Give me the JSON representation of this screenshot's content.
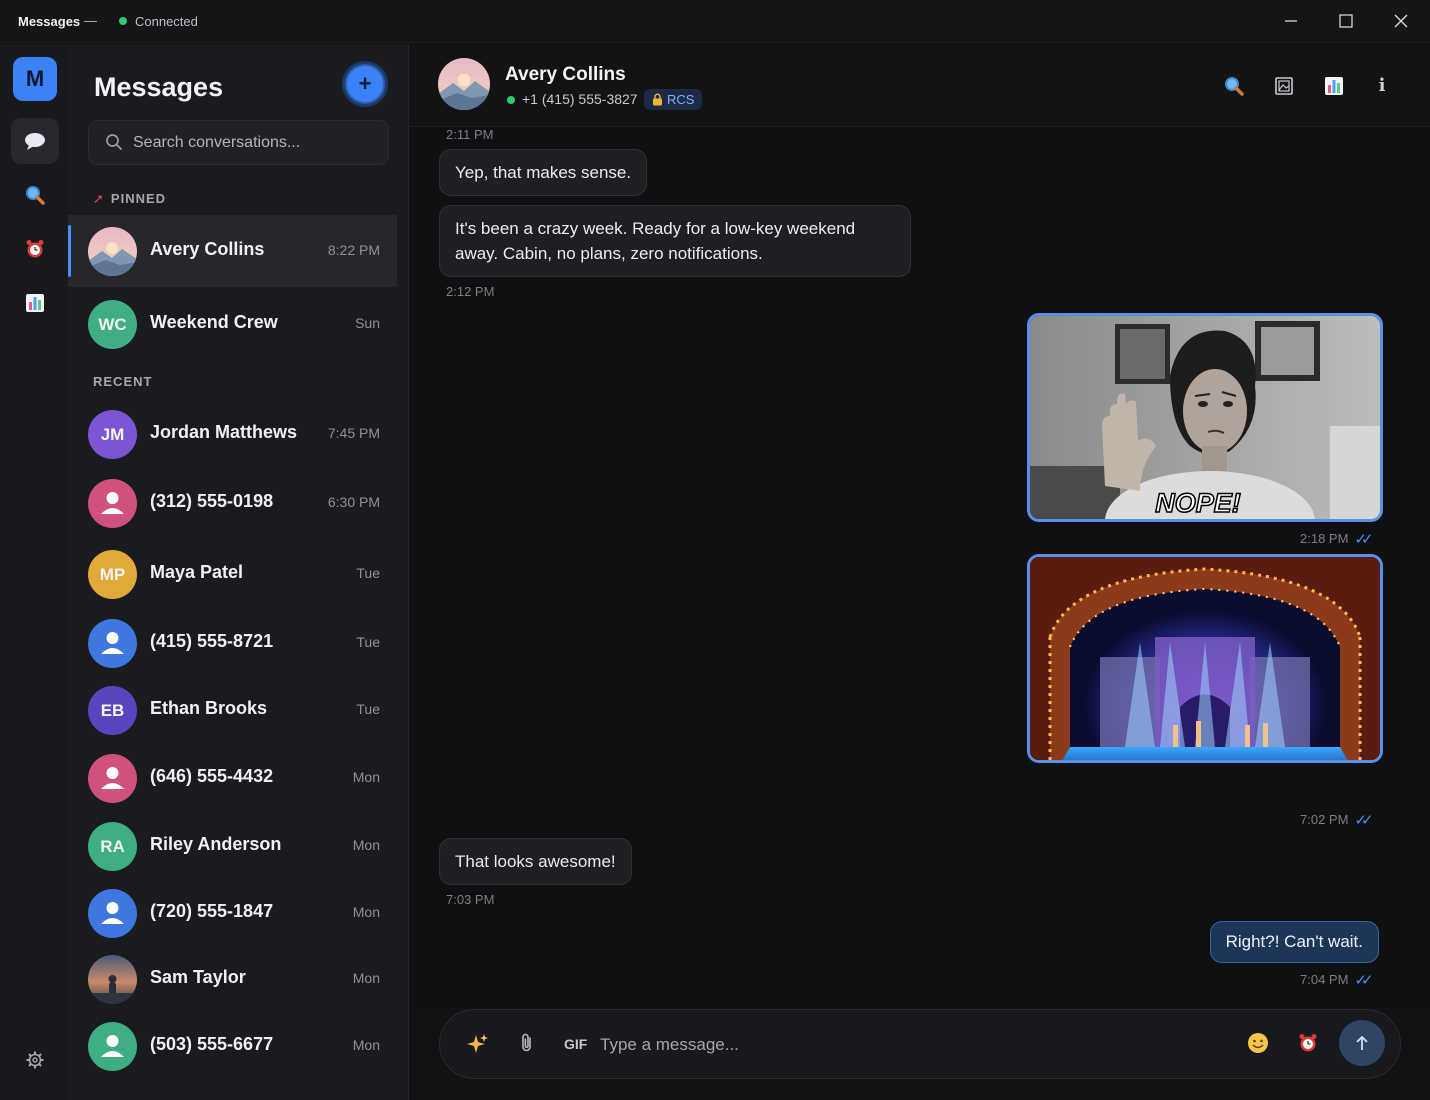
{
  "titlebar": {
    "app_name": "Messages",
    "separator": "—",
    "status": "Connected"
  },
  "rail": {
    "account_initial": "M"
  },
  "sidebar": {
    "title": "Messages",
    "new_label": "+",
    "search_placeholder": "Search conversations...",
    "pinned_label": "PINNED",
    "recent_label": "RECENT",
    "pinned": [
      {
        "name": "Avery Collins",
        "time": "8:22 PM",
        "initials": "",
        "color": "#d9a5b8"
      },
      {
        "name": "Weekend Crew",
        "time": "Sun",
        "initials": "WC",
        "color": "#3fae84"
      }
    ],
    "recent": [
      {
        "name": "Jordan Matthews",
        "time": "7:45 PM",
        "initials": "JM",
        "color": "#7b55d4"
      },
      {
        "name": "(312) 555-0198",
        "time": "6:30 PM",
        "initials": "",
        "color": "#d0507e"
      },
      {
        "name": "Maya Patel",
        "time": "Tue",
        "initials": "MP",
        "color": "#e0a93a"
      },
      {
        "name": "(415) 555-8721",
        "time": "Tue",
        "initials": "",
        "color": "#3e78de"
      },
      {
        "name": "Ethan Brooks",
        "time": "Tue",
        "initials": "EB",
        "color": "#5a45c0"
      },
      {
        "name": "(646) 555-4432",
        "time": "Mon",
        "initials": "",
        "color": "#d0507e"
      },
      {
        "name": "Riley Anderson",
        "time": "Mon",
        "initials": "RA",
        "color": "#3fae84"
      },
      {
        "name": "(720) 555-1847",
        "time": "Mon",
        "initials": "",
        "color": "#3e78de"
      },
      {
        "name": "Sam Taylor",
        "time": "Mon",
        "initials": "",
        "color": "#5a6478"
      },
      {
        "name": "(503) 555-6677",
        "time": "Mon",
        "initials": "",
        "color": "#3fae84"
      }
    ]
  },
  "chat_header": {
    "name": "Avery Collins",
    "phone": "+1 (415) 555-3827",
    "badge": "RCS"
  },
  "messages": {
    "t0": "2:11 PM",
    "m1": "Yep, that makes sense.",
    "m2": "It's been a crazy week. Ready for a low-key weekend away. Cabin, no plans, zero notifications.",
    "t1": "2:12 PM",
    "img1_caption": "NOPE!",
    "t2": "2:18 PM",
    "t3": "7:02 PM",
    "m3": "That looks awesome!",
    "t4": "7:03 PM",
    "m4": "Right?! Can't wait.",
    "t5": "7:04 PM"
  },
  "composer": {
    "gif_label": "GIF",
    "placeholder": "Type a message..."
  },
  "colors": {
    "accent": "#3b82f6",
    "online": "#2ecc71",
    "outgoing_bubble": "#1d3557"
  }
}
